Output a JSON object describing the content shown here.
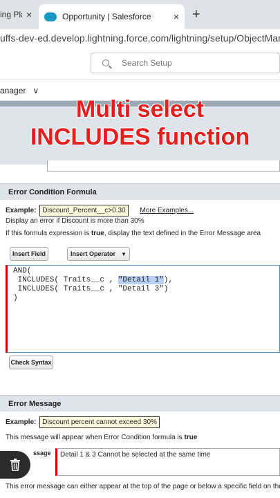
{
  "browser": {
    "tab1_title": "ing Pla",
    "tab2_title": "Opportunity | Salesforce",
    "close_glyph": "×",
    "new_tab_glyph": "+",
    "url": "uffs-dev-ed.develop.lightning.force.com/lightning/setup/ObjectManag"
  },
  "setup": {
    "search_placeholder": "Search Setup",
    "object_tab_label": "anager",
    "object_tab_chevron": "∨"
  },
  "overlay": {
    "line1": "Multi select",
    "line2": "INCLUDES function"
  },
  "formula_section": {
    "title": "Error Condition Formula",
    "example_label": "Example:",
    "example_value": "Discount_Percent__c>0.30",
    "more_examples": "More Examples...",
    "desc1": "Display an error if Discount is more than 30%",
    "desc2_pre": "If this formula expression is ",
    "desc2_bold": "true",
    "desc2_post": ", display the text defined in the Error Message area",
    "insert_field": "Insert Field",
    "insert_operator": "Insert Operator",
    "check_syntax": "Check Syntax",
    "formula_line1": "AND(",
    "formula_line2_pre": " INCLUDES( Traits__c , ",
    "formula_line2_hl": "\"Detail 1\"",
    "formula_line2_post": "),",
    "formula_line3": " INCLUDES( Traits__c , \"Detail 3\")",
    "formula_line4": ")"
  },
  "message_section": {
    "title": "Error Message",
    "example_label": "Example:",
    "example_value": "Discount percent cannot exceed 30%",
    "desc_pre": "This message will appear when Error Condition formula is ",
    "desc_bold": "true",
    "field_label": "ssage",
    "error_text": "Detail 1 & 3 Cannot be selected at the same time",
    "footer": "This error message can either appear at the top of the page or below a specific field on the"
  }
}
